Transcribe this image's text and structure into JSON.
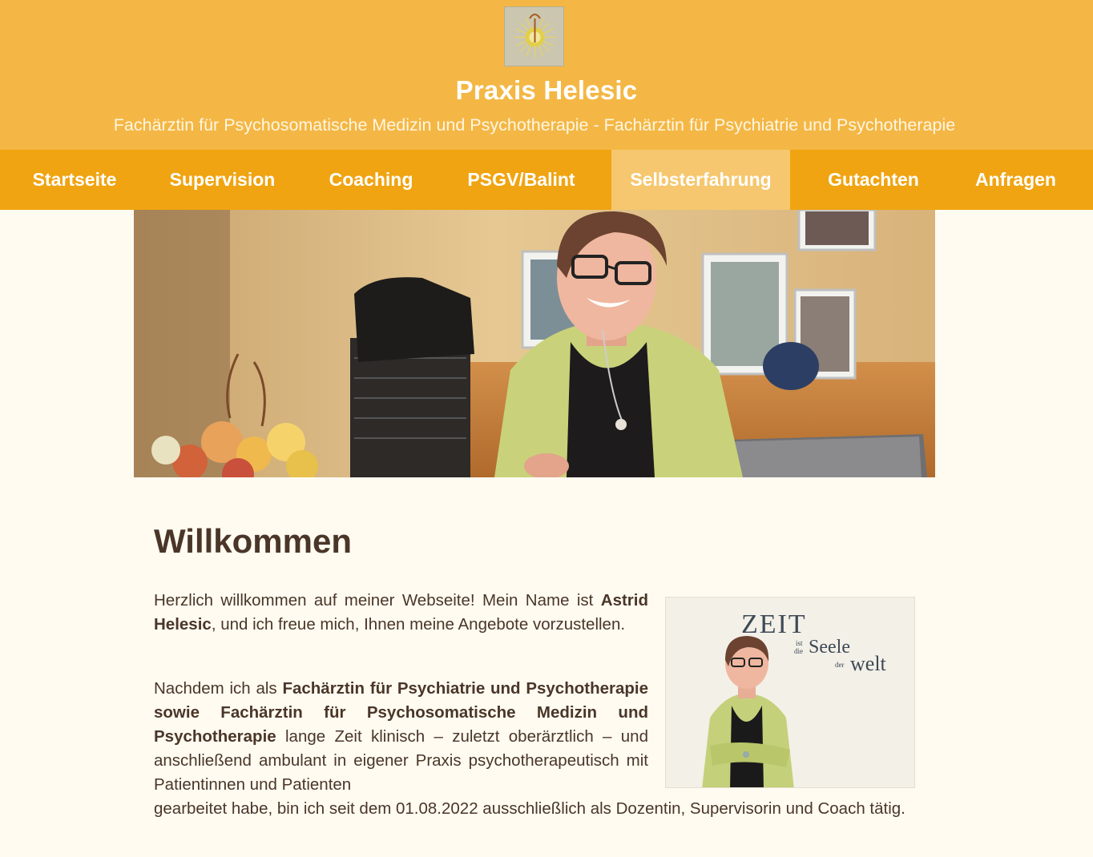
{
  "site": {
    "title": "Praxis Helesic",
    "subtitle": "Fachärztin für Psychosomatische Medizin und Psychotherapie - Fachärztin für Psychiatrie und Psychotherapie",
    "logo_icon": "sun-figure-logo-icon"
  },
  "nav": {
    "items": [
      {
        "label": "Startseite"
      },
      {
        "label": "Supervision"
      },
      {
        "label": "Coaching"
      },
      {
        "label": "PSGV/Balint"
      },
      {
        "label": "Selbsterfahrung",
        "active": true
      },
      {
        "label": "Gutachten"
      },
      {
        "label": "Anfragen"
      }
    ]
  },
  "content": {
    "heading": "Willkommen",
    "p1_a": "Herzlich willkommen auf meiner Webseite! Mein Name ist ",
    "p1_b": "Astrid Helesic",
    "p1_c": ", und ich freue mich, Ihnen meine Angebote vorzustellen.",
    "p2_a": "Nachdem ich als ",
    "p2_b": "Fachärztin für Psychiatrie und Psychotherapie sowie Fachärztin für Psychosomatische Medizin und Psychotherapie",
    "p2_c": " lange Zeit klinisch – zuletzt oberärztlich – und anschließend ambulant in eigener Praxis psychotherapeutisch mit Patientinnen und Patienten gearbeitet habe, bin ich seit dem 01.08.2022 ausschließlich als Dozentin, Supervisorin und Coach tätig."
  },
  "side_photo": {
    "text_zeit": "ZEIT",
    "text_ist": "ist",
    "text_die": "die",
    "text_seele": "Seele",
    "text_der": "der",
    "text_welt": "welt"
  },
  "colors": {
    "header": "#f4b745",
    "nav": "#f0a411",
    "nav_active": "#f6c76e",
    "background": "#fffbf1",
    "text": "#4a3628"
  }
}
